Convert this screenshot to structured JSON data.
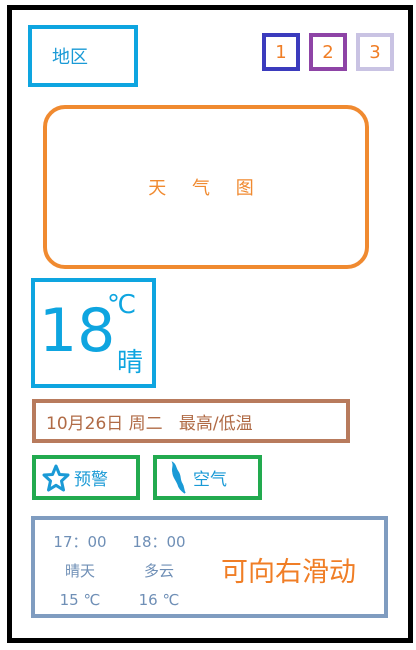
{
  "header": {
    "region_label": "地区",
    "pages": [
      "1",
      "2",
      "3"
    ]
  },
  "weather_map": {
    "label": "天 气 图"
  },
  "current": {
    "temperature": "18",
    "unit": "℃",
    "condition": "晴"
  },
  "date_line": "10月26日 周二   最高/低温",
  "buttons": {
    "warning_label": "预警",
    "air_label": "空气"
  },
  "forecast": {
    "items": [
      {
        "time": "17：00",
        "condition": "晴天",
        "temp": "15 ℃"
      },
      {
        "time": "18：00",
        "condition": "多云",
        "temp": "16 ℃"
      }
    ],
    "swipe_hint": "可向右滑动"
  },
  "colors": {
    "blue": "#0ea5e0",
    "orange": "#f08a30",
    "green": "#22aa4f",
    "brown": "#b87b5d",
    "slate": "#7f9cc0"
  }
}
